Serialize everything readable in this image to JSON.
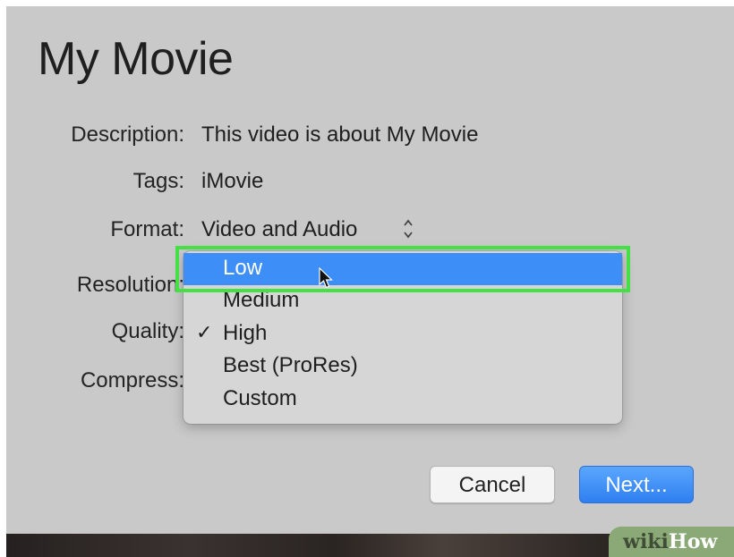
{
  "dialog": {
    "title": "My Movie",
    "fields": {
      "description": {
        "label": "Description:",
        "value": "This video is about My Movie"
      },
      "tags": {
        "label": "Tags:",
        "value": "iMovie"
      },
      "format": {
        "label": "Format:",
        "value": "Video and Audio"
      },
      "resolution": {
        "label": "Resolution:"
      },
      "quality": {
        "label": "Quality:"
      },
      "compress": {
        "label": "Compress:"
      }
    },
    "resolution_menu": {
      "items": [
        {
          "label": "Low",
          "highlighted": true
        },
        {
          "label": "Medium"
        },
        {
          "label": "High",
          "checked": true
        },
        {
          "label": "Best (ProRes)"
        },
        {
          "label": "Custom"
        }
      ],
      "check_glyph": "✓"
    },
    "buttons": {
      "cancel": "Cancel",
      "next": "Next..."
    }
  },
  "watermark": {
    "part1": "wiki",
    "part2": "How"
  },
  "colors": {
    "dialog_bg": "#c9c9c9",
    "menu_highlight": "#3d8ef7",
    "annotation_box": "#45e045",
    "primary_button": "#2f7ff0"
  }
}
